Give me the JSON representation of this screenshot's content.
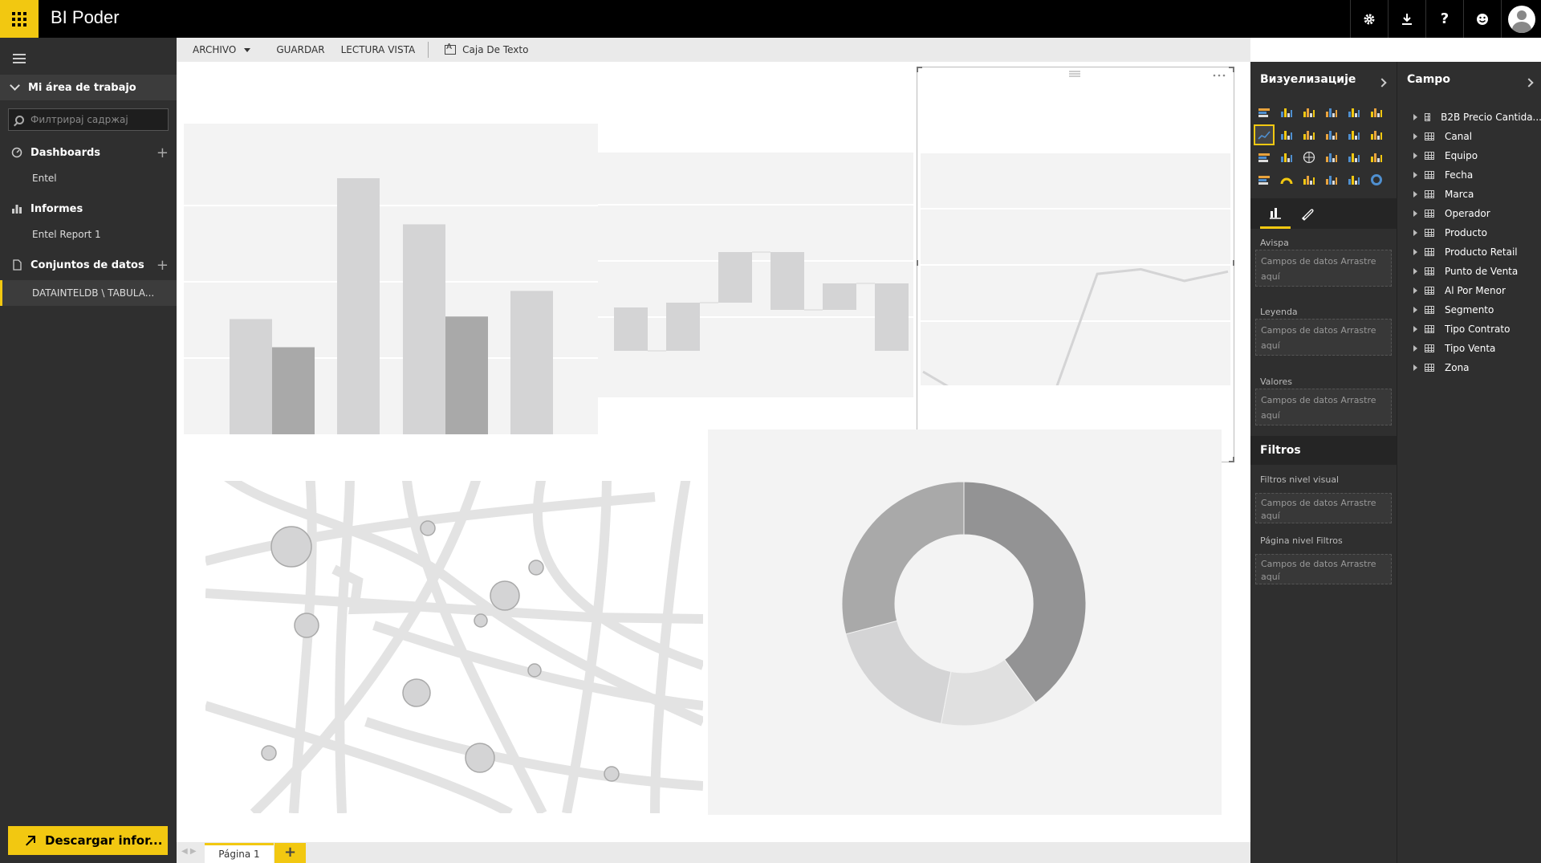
{
  "app": {
    "title": "BI Poder"
  },
  "topbar": {
    "icons": [
      "gear-icon",
      "download-icon",
      "help-icon",
      "smiley-icon",
      "avatar-icon"
    ],
    "help_glyph": "?"
  },
  "nav": {
    "workspace": "Mi área de trabajo",
    "filter_placeholder": "Филтрирај садржај",
    "dashboards": {
      "label": "Dashboards",
      "items": [
        "Entel"
      ]
    },
    "reports": {
      "label": "Informes",
      "items": [
        "Entel Report 1"
      ]
    },
    "datasets": {
      "label": "Conjuntos de datos",
      "items": [
        "DATAINTELDB \\ TABULA..."
      ]
    },
    "download_label": "Descargar infor..."
  },
  "toolbar": {
    "file_label": "ARCHIVO",
    "save_label": "GUARDAR",
    "reading_view_label": "LECTURA VISTA",
    "textbox_label": "Caja De Texto"
  },
  "pages": {
    "tab": "Página 1",
    "add": "+"
  },
  "viz_pane": {
    "title": "Визуелизације",
    "axis_label": "Avispa",
    "legend_label": "Leyenda",
    "values_label": "Valores",
    "drop_text_1": "Campos de datos Arrastre",
    "drop_text_2": "aquí",
    "filters_title": "Filtros",
    "visual_filters_label": "Filtros nivel visual",
    "page_filters_label": "Página nivel Filtros",
    "drop_text_full": "Campos de datos Arrastre aquí"
  },
  "fields_pane": {
    "title": "Campo",
    "fields": [
      "B2B Precio Cantida...",
      "Canal",
      "Equipo",
      "Fecha",
      "Marca",
      "Operador",
      "Producto",
      "Producto Retail",
      "Punto de Venta",
      "Al Por Menor",
      "Segmento",
      "Tipo Contrato",
      "Tipo Venta",
      "Zona"
    ]
  },
  "colors": {
    "accent": "#f2c811",
    "dark": "#2f2f2f",
    "placeholder_light": "#d4d4d5",
    "placeholder_dark": "#a9a9a9"
  },
  "chart_data": [
    {
      "type": "bar",
      "series": [
        {
          "values": [
            0.45,
            1.0,
            0.82,
            0.56
          ]
        },
        {
          "values": [
            0.34,
            null,
            0.46,
            null
          ]
        }
      ]
    },
    {
      "type": "waterfall",
      "values": [
        -0.18,
        0.2,
        0.21,
        -0.24,
        0.11,
        -0.28
      ]
    },
    {
      "type": "line",
      "values": [
        0.3,
        0.19,
        0.22,
        0.2,
        0.72,
        0.74,
        0.69,
        0.73
      ]
    },
    {
      "type": "pie",
      "values": [
        40,
        13,
        18,
        29
      ]
    }
  ]
}
